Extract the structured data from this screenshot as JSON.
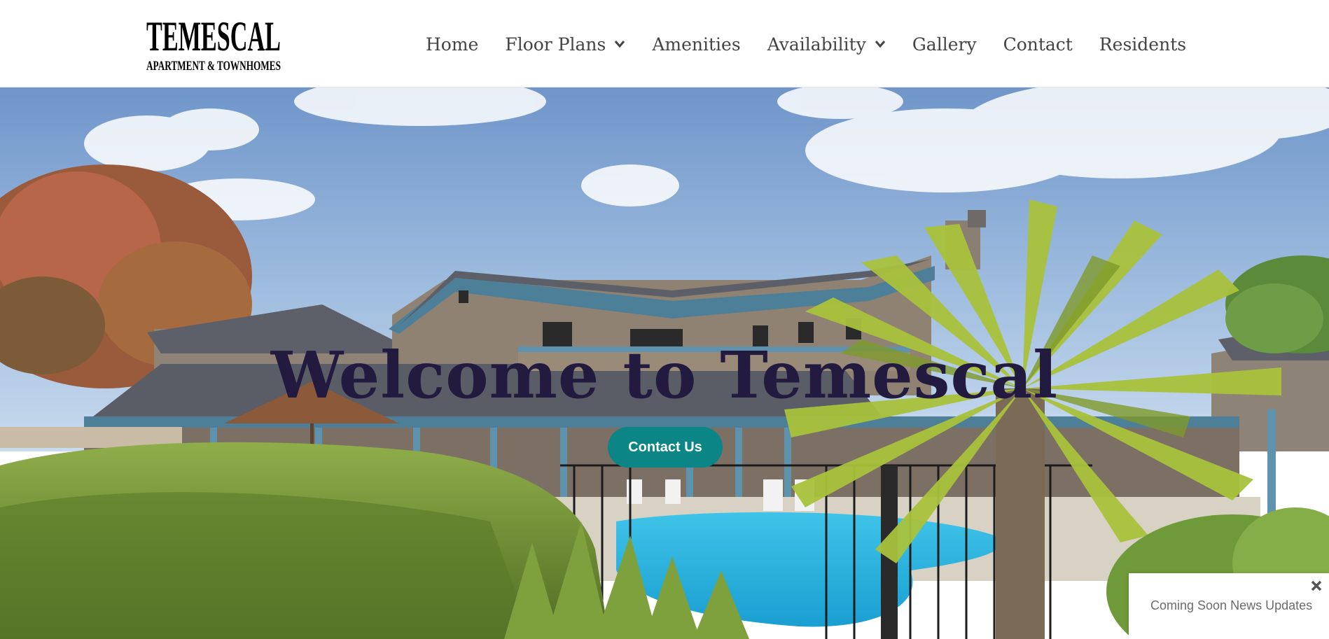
{
  "header": {
    "logo": {
      "title": "TEMESCAL",
      "subtitle": "APARTMENT & TOWNHOMES"
    },
    "nav": [
      {
        "label": "Home",
        "has_dropdown": false
      },
      {
        "label": "Floor Plans",
        "has_dropdown": true
      },
      {
        "label": "Amenities",
        "has_dropdown": false
      },
      {
        "label": "Availability",
        "has_dropdown": true
      },
      {
        "label": "Gallery",
        "has_dropdown": false
      },
      {
        "label": "Contact",
        "has_dropdown": false
      },
      {
        "label": "Residents",
        "has_dropdown": false
      }
    ]
  },
  "hero": {
    "title": "Welcome to Temescal",
    "cta_label": "Contact Us"
  },
  "news_popup": {
    "text": "Coming Soon News Updates"
  },
  "colors": {
    "nav_text": "#444444",
    "hero_title": "#231a40",
    "cta_bg": "#0b8585",
    "cta_text": "#ffffff",
    "popup_text": "#6b6b6b"
  }
}
